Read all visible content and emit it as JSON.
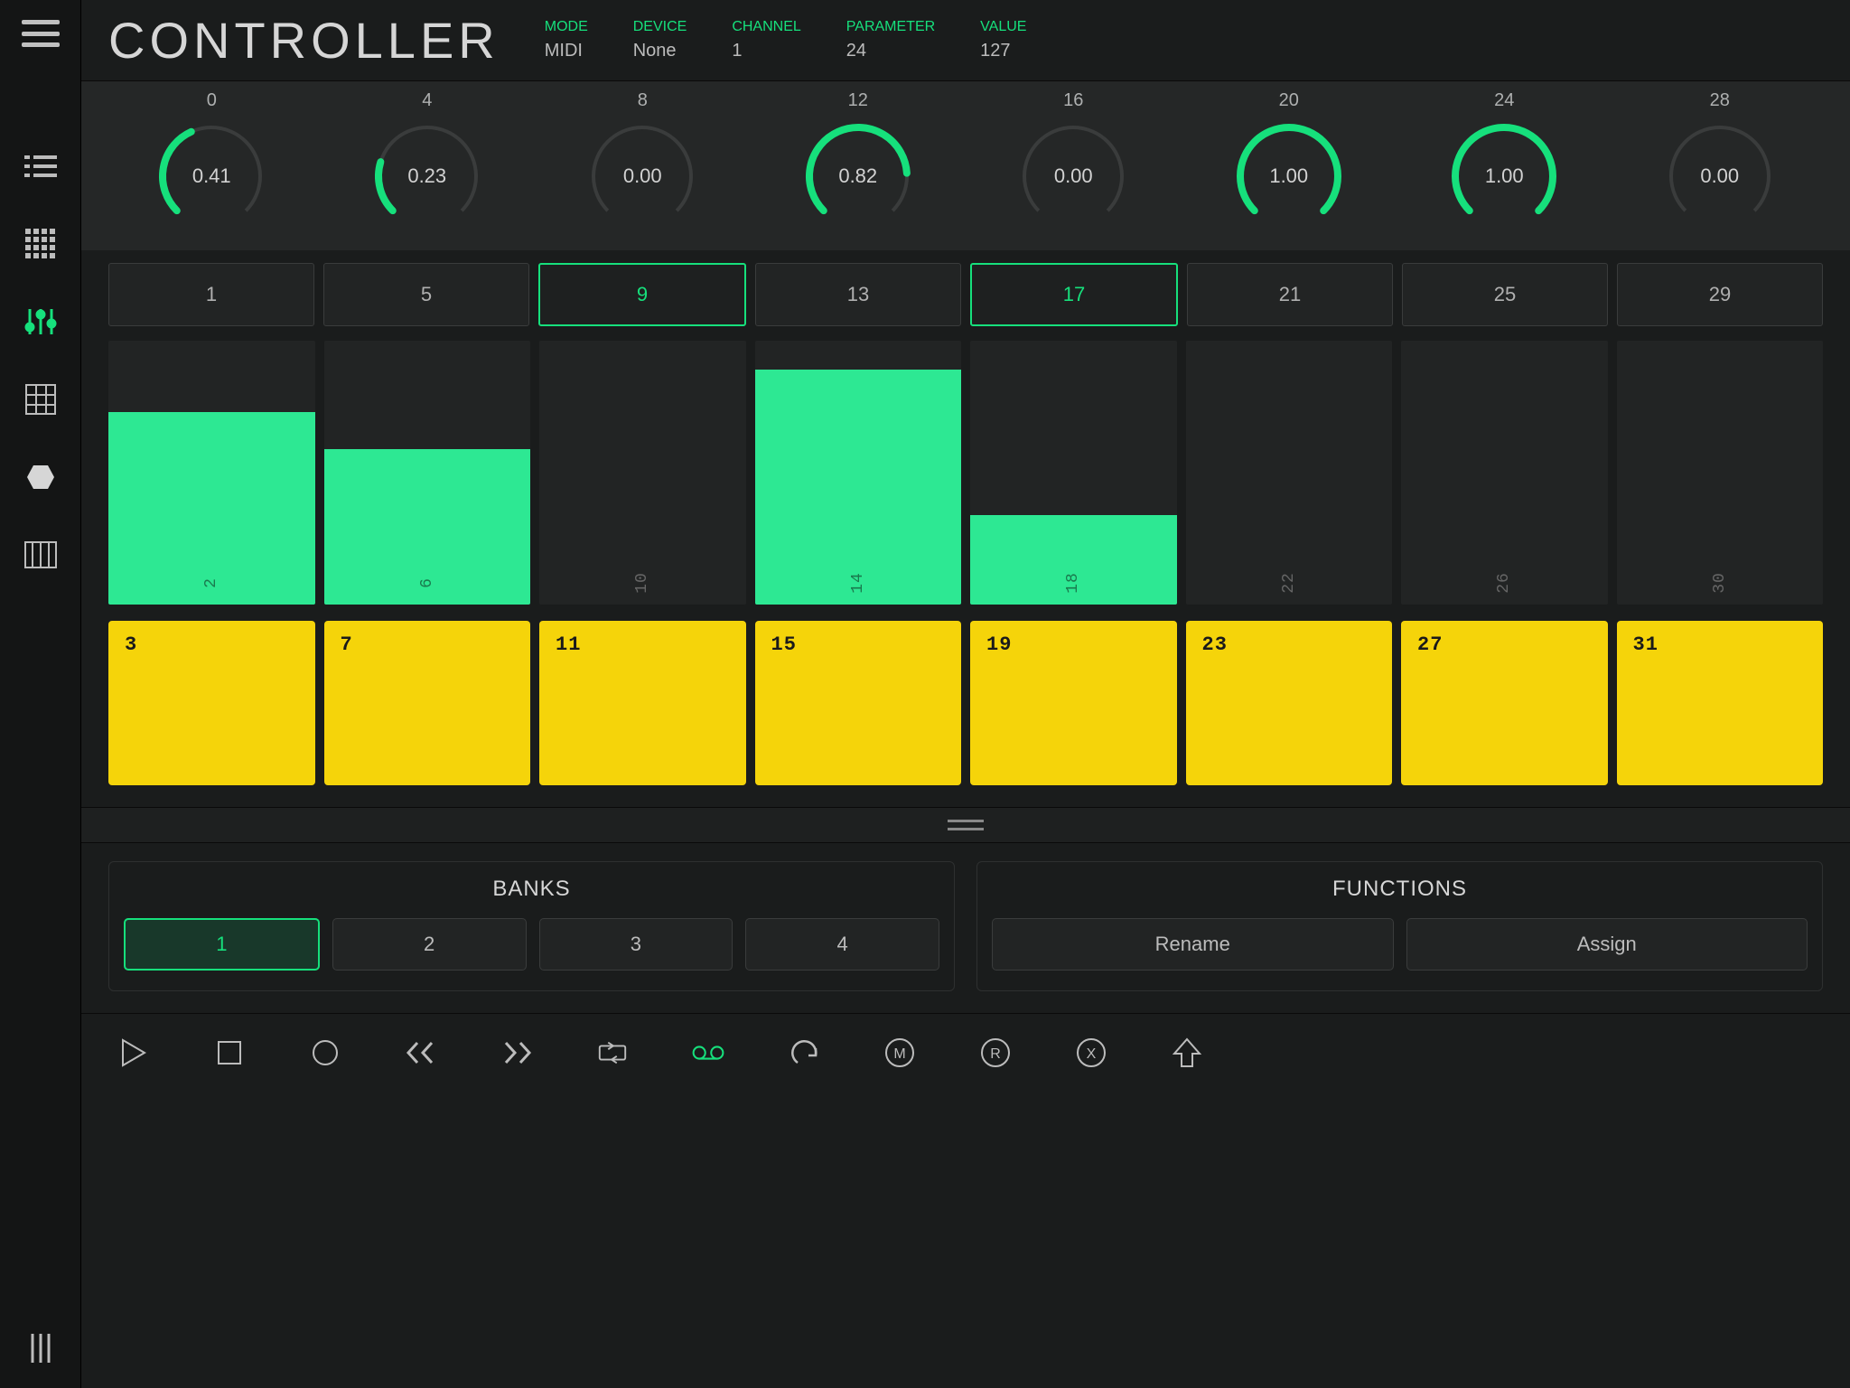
{
  "title": "CONTROLLER",
  "header_params": [
    {
      "label": "MODE",
      "value": "MIDI"
    },
    {
      "label": "DEVICE",
      "value": "None"
    },
    {
      "label": "CHANNEL",
      "value": "1"
    },
    {
      "label": "PARAMETER",
      "value": "24"
    },
    {
      "label": "VALUE",
      "value": "127"
    }
  ],
  "knobs": [
    {
      "num": "0",
      "val": "0.41",
      "pct": 0.41
    },
    {
      "num": "4",
      "val": "0.23",
      "pct": 0.23
    },
    {
      "num": "8",
      "val": "0.00",
      "pct": 0.0
    },
    {
      "num": "12",
      "val": "0.82",
      "pct": 0.82
    },
    {
      "num": "16",
      "val": "0.00",
      "pct": 0.0
    },
    {
      "num": "20",
      "val": "1.00",
      "pct": 1.0
    },
    {
      "num": "24",
      "val": "1.00",
      "pct": 1.0
    },
    {
      "num": "28",
      "val": "0.00",
      "pct": 0.0
    }
  ],
  "buttons_row": [
    {
      "label": "1",
      "active": false
    },
    {
      "label": "5",
      "active": false
    },
    {
      "label": "9",
      "active": true
    },
    {
      "label": "13",
      "active": false
    },
    {
      "label": "17",
      "active": true
    },
    {
      "label": "21",
      "active": false
    },
    {
      "label": "25",
      "active": false
    },
    {
      "label": "29",
      "active": false
    }
  ],
  "faders": [
    {
      "num": "2",
      "pct": 0.73
    },
    {
      "num": "6",
      "pct": 0.59
    },
    {
      "num": "10",
      "pct": 0.0
    },
    {
      "num": "14",
      "pct": 0.89
    },
    {
      "num": "18",
      "pct": 0.34
    },
    {
      "num": "22",
      "pct": 0.0
    },
    {
      "num": "26",
      "pct": 0.0
    },
    {
      "num": "30",
      "pct": 0.0
    }
  ],
  "pads": [
    "3",
    "7",
    "11",
    "15",
    "19",
    "23",
    "27",
    "31"
  ],
  "banks": {
    "title": "BANKS",
    "items": [
      {
        "label": "1",
        "active": true
      },
      {
        "label": "2",
        "active": false
      },
      {
        "label": "3",
        "active": false
      },
      {
        "label": "4",
        "active": false
      }
    ]
  },
  "functions": {
    "title": "FUNCTIONS",
    "items": [
      {
        "label": "Rename"
      },
      {
        "label": "Assign"
      }
    ]
  },
  "sidebar_active_index": 2,
  "transport_active_index": 5
}
